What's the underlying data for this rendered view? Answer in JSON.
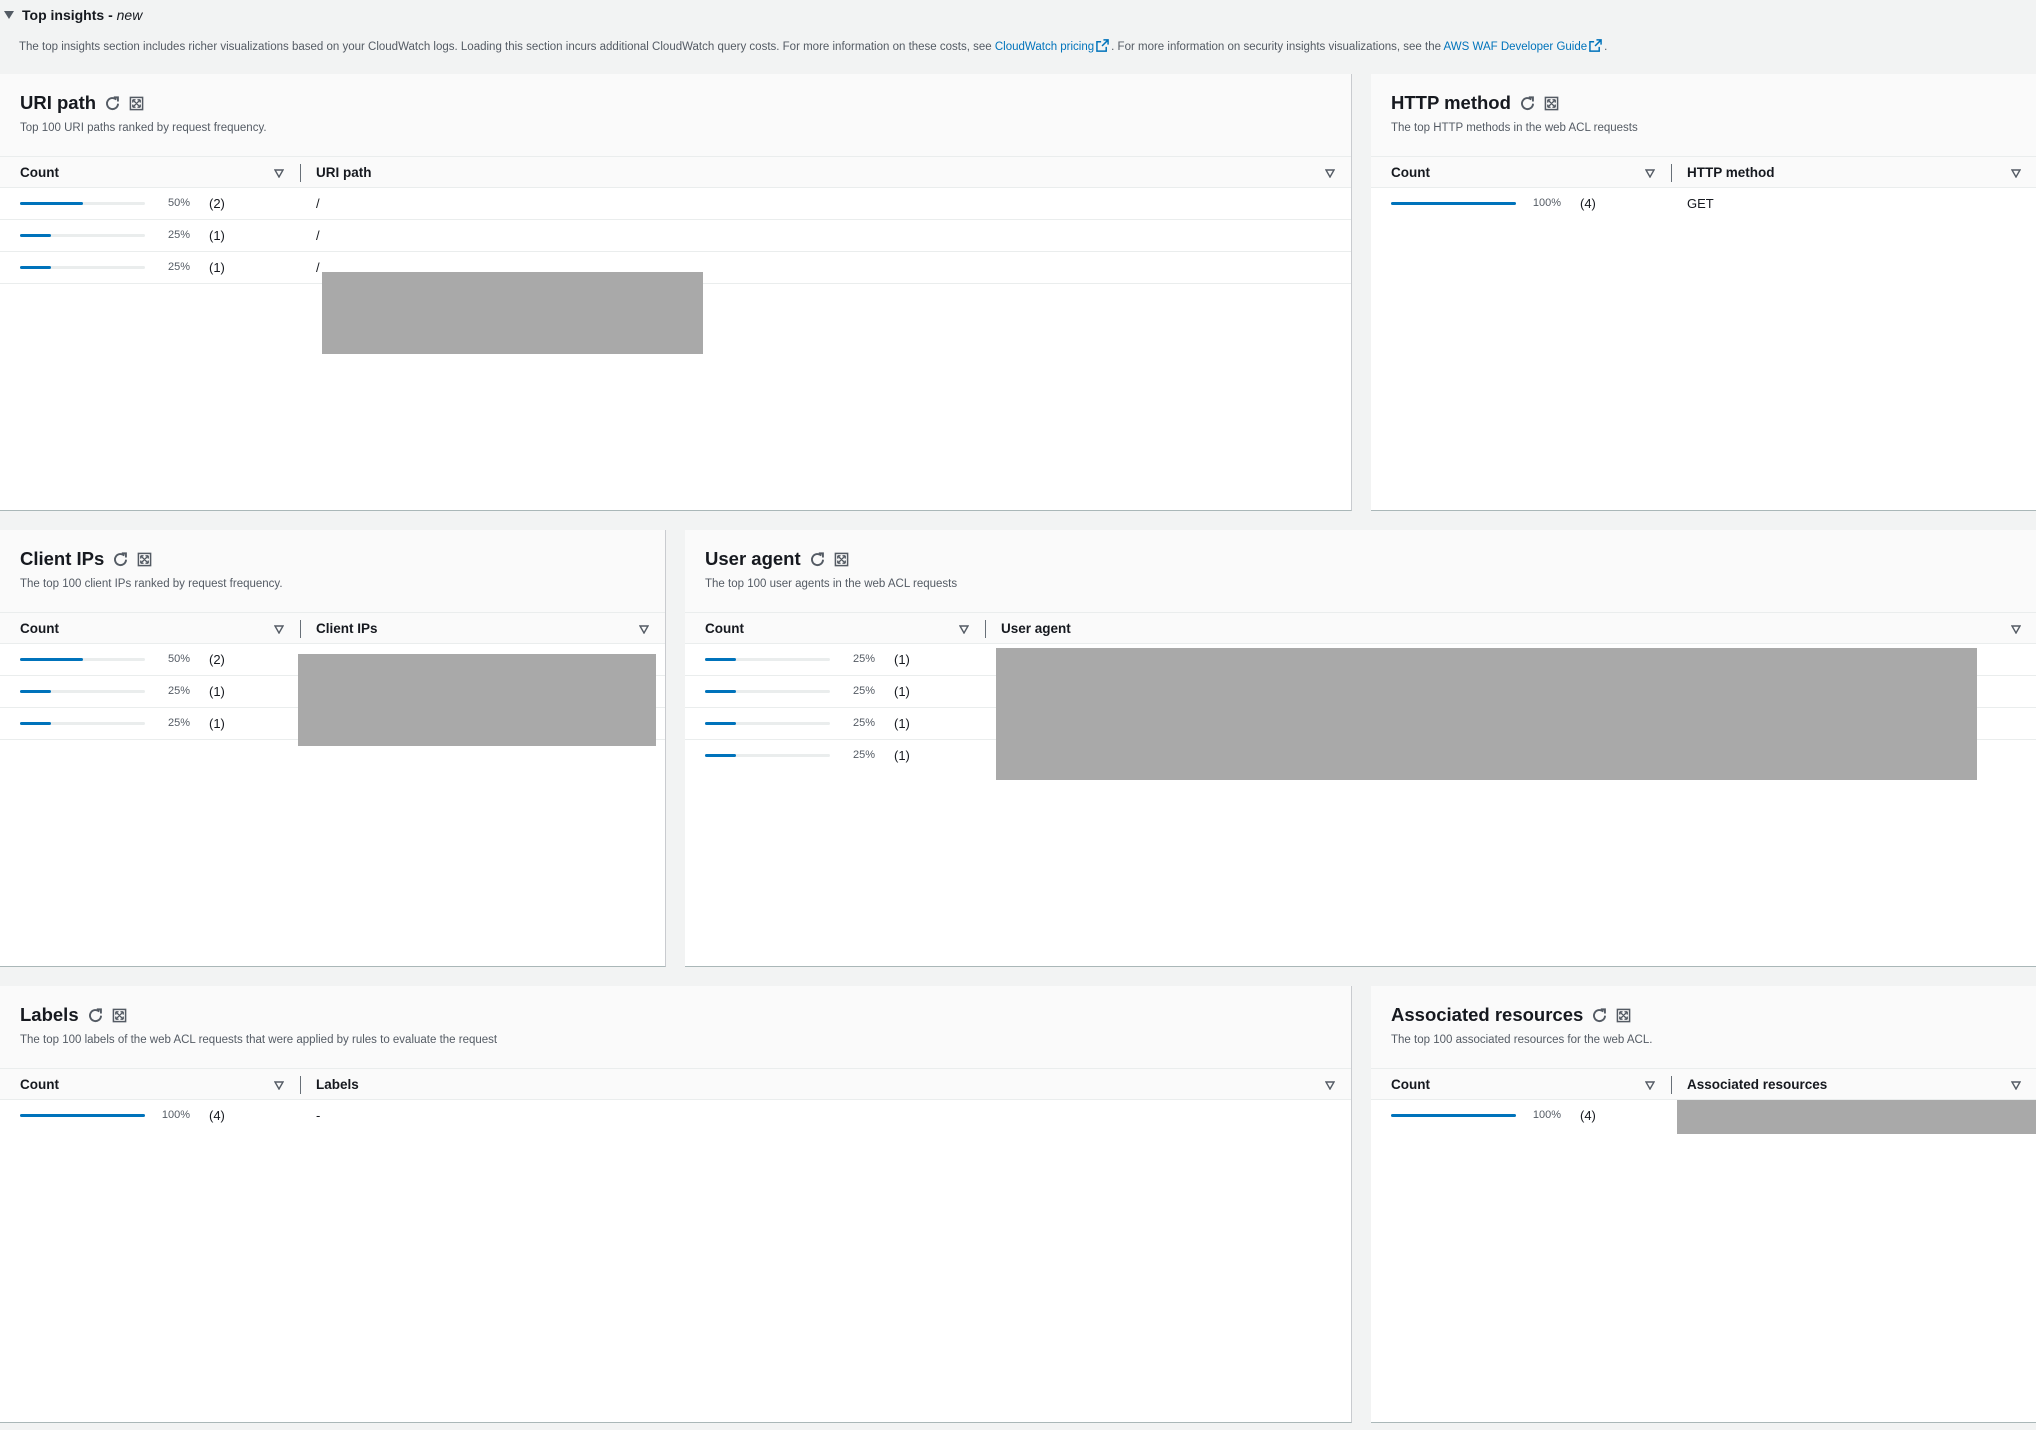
{
  "section": {
    "title": "Top insights - ",
    "badge": "new",
    "desc_1": "The top insights section includes richer visualizations based on your CloudWatch logs. Loading this section incurs additional CloudWatch query costs. For more information on these costs, see ",
    "link_1": "CloudWatch pricing",
    "desc_2": ". For more information on security insights visualizations, see the ",
    "link_2": "AWS WAF Developer Guide",
    "desc_3": "."
  },
  "colors": {
    "accent": "#0073bb",
    "redaction": "#a9a9a9"
  },
  "icons": [
    "caret-down-icon",
    "refresh-icon",
    "expand-icon",
    "external-link-icon",
    "sort-icon"
  ],
  "panels": {
    "uri": {
      "title": "URI path",
      "desc": "Top 100 URI paths ranked by request frequency.",
      "col_count": "Count",
      "col_value": "URI path",
      "rows": [
        {
          "pct": "50%",
          "count": "(2)",
          "value": "/",
          "fill": 0.5
        },
        {
          "pct": "25%",
          "count": "(1)",
          "value": "/",
          "fill": 0.25
        },
        {
          "pct": "25%",
          "count": "(1)",
          "value": "/",
          "fill": 0.25
        }
      ]
    },
    "http": {
      "title": "HTTP method",
      "desc": "The top HTTP methods in the web ACL requests",
      "col_count": "Count",
      "col_value": "HTTP method",
      "rows": [
        {
          "pct": "100%",
          "count": "(4)",
          "value": "GET",
          "fill": 1.0
        }
      ]
    },
    "clients": {
      "title": "Client IPs",
      "desc": "The top 100 client IPs ranked by request frequency.",
      "col_count": "Count",
      "col_value": "Client IPs",
      "rows": [
        {
          "pct": "50%",
          "count": "(2)",
          "fill": 0.5
        },
        {
          "pct": "25%",
          "count": "(1)",
          "fill": 0.25
        },
        {
          "pct": "25%",
          "count": "(1)",
          "fill": 0.25
        }
      ]
    },
    "agent": {
      "title": "User agent",
      "desc": "The top 100 user agents in the web ACL requests",
      "col_count": "Count",
      "col_value": "User agent",
      "rows": [
        {
          "pct": "25%",
          "count": "(1)",
          "fill": 0.25
        },
        {
          "pct": "25%",
          "count": "(1)",
          "fill": 0.25
        },
        {
          "pct": "25%",
          "count": "(1)",
          "fill": 0.25
        },
        {
          "pct": "25%",
          "count": "(1)",
          "fill": 0.25
        }
      ]
    },
    "labels": {
      "title": "Labels",
      "desc": "The top 100 labels of the web ACL requests that were applied by rules to evaluate the request",
      "col_count": "Count",
      "col_value": "Labels",
      "rows": [
        {
          "pct": "100%",
          "count": "(4)",
          "value": "-",
          "fill": 1.0
        }
      ]
    },
    "resources": {
      "title": "Associated resources",
      "desc": "The top 100 associated resources for the web ACL.",
      "col_count": "Count",
      "col_value": "Associated resources",
      "rows": [
        {
          "pct": "100%",
          "count": "(4)",
          "fill": 1.0
        }
      ]
    }
  }
}
